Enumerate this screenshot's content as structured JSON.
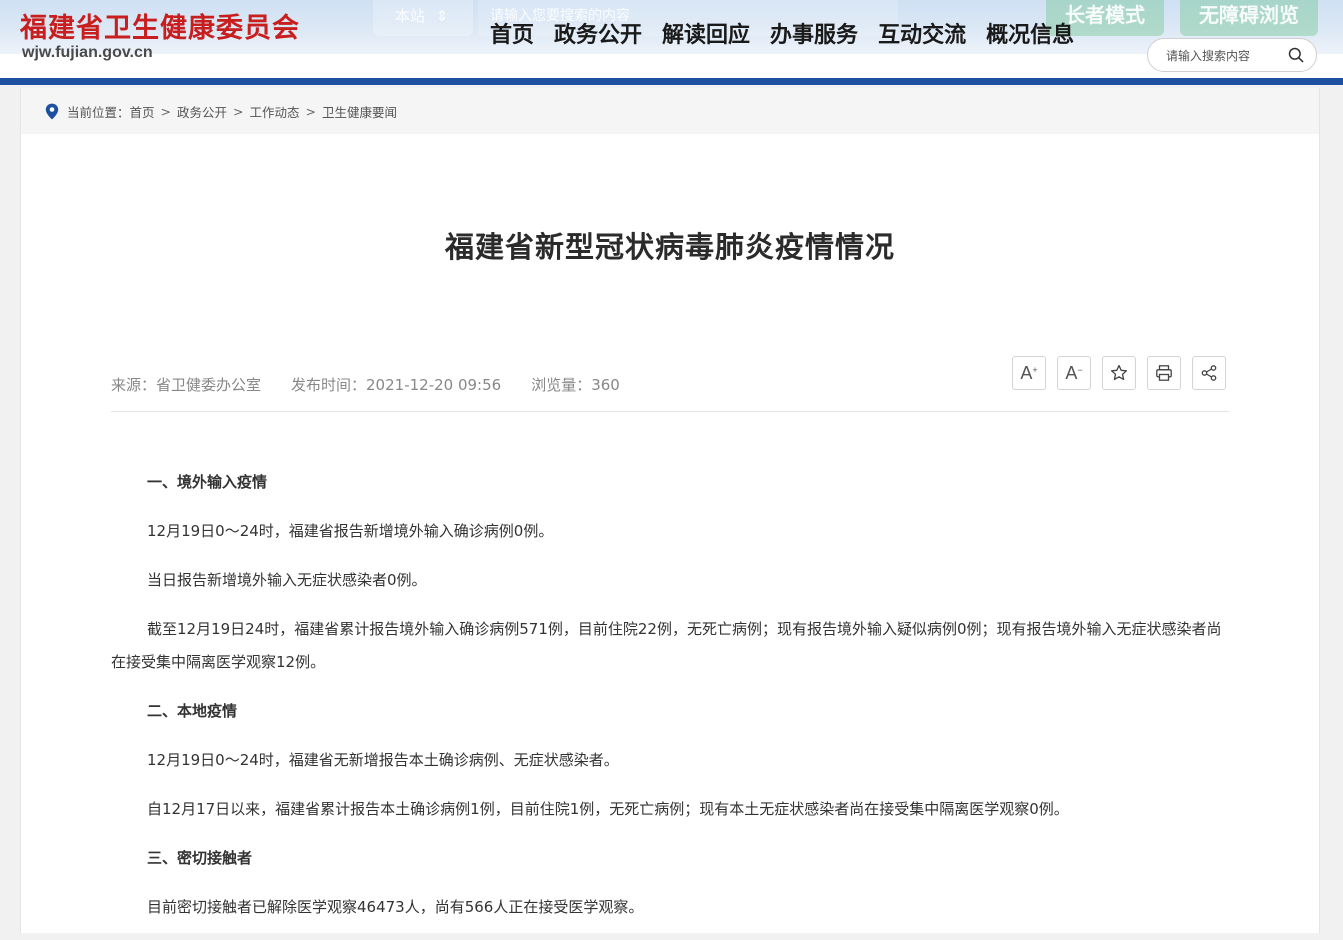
{
  "header": {
    "site_title": "福建省卫生健康委员会",
    "site_domain": "wjw.fujian.gov.cn",
    "scope_label": "本站",
    "hidden_search_placeholder": "请输入您要搜索的内容",
    "elder_mode_label": "长者模式",
    "accessibility_label": "无障碍浏览",
    "nav": [
      "首页",
      "政务公开",
      "解读回应",
      "办事服务",
      "互动交流",
      "概况信息"
    ],
    "search_placeholder": "请输入搜索内容"
  },
  "breadcrumb": {
    "prefix": "当前位置：",
    "items": [
      "首页",
      "政务公开",
      "工作动态",
      "卫生健康要闻"
    ],
    "separator": ">"
  },
  "article": {
    "title": "福建省新型冠状病毒肺炎疫情情况",
    "source": "来源：省卫健委办公室",
    "published": "发布时间：2021-12-20 09:56",
    "views": "浏览量：360",
    "paragraphs": [
      {
        "heading": true,
        "text": "一、境外输入疫情"
      },
      {
        "heading": false,
        "text": "12月19日0～24时，福建省报告新增境外输入确诊病例0例。"
      },
      {
        "heading": false,
        "text": "当日报告新增境外输入无症状感染者0例。"
      },
      {
        "heading": false,
        "text": "截至12月19日24时，福建省累计报告境外输入确诊病例571例，目前住院22例，无死亡病例；现有报告境外输入疑似病例0例；现有报告境外输入无症状感染者尚在接受集中隔离医学观察12例。"
      },
      {
        "heading": true,
        "text": "二、本地疫情"
      },
      {
        "heading": false,
        "text": "12月19日0～24时，福建省无新增报告本土确诊病例、无症状感染者。"
      },
      {
        "heading": false,
        "text": "自12月17日以来，福建省累计报告本土确诊病例1例，目前住院1例，无死亡病例；现有本土无症状感染者尚在接受集中隔离医学观察0例。"
      },
      {
        "heading": true,
        "text": "三、密切接触者"
      },
      {
        "heading": false,
        "text": "目前密切接触者已解除医学观察46473人，尚有566人正在接受医学观察。"
      }
    ]
  },
  "tools": [
    {
      "name": "font-increase-button",
      "label": "A",
      "sup": "+"
    },
    {
      "name": "font-decrease-button",
      "label": "A",
      "sup": "−"
    },
    {
      "name": "favorite-button",
      "icon": "star-icon"
    },
    {
      "name": "print-button",
      "icon": "printer-icon"
    },
    {
      "name": "share-button",
      "icon": "share-icon"
    }
  ],
  "colors": {
    "brand_red": "#c81e1e",
    "brand_blue": "#1e50a2"
  }
}
